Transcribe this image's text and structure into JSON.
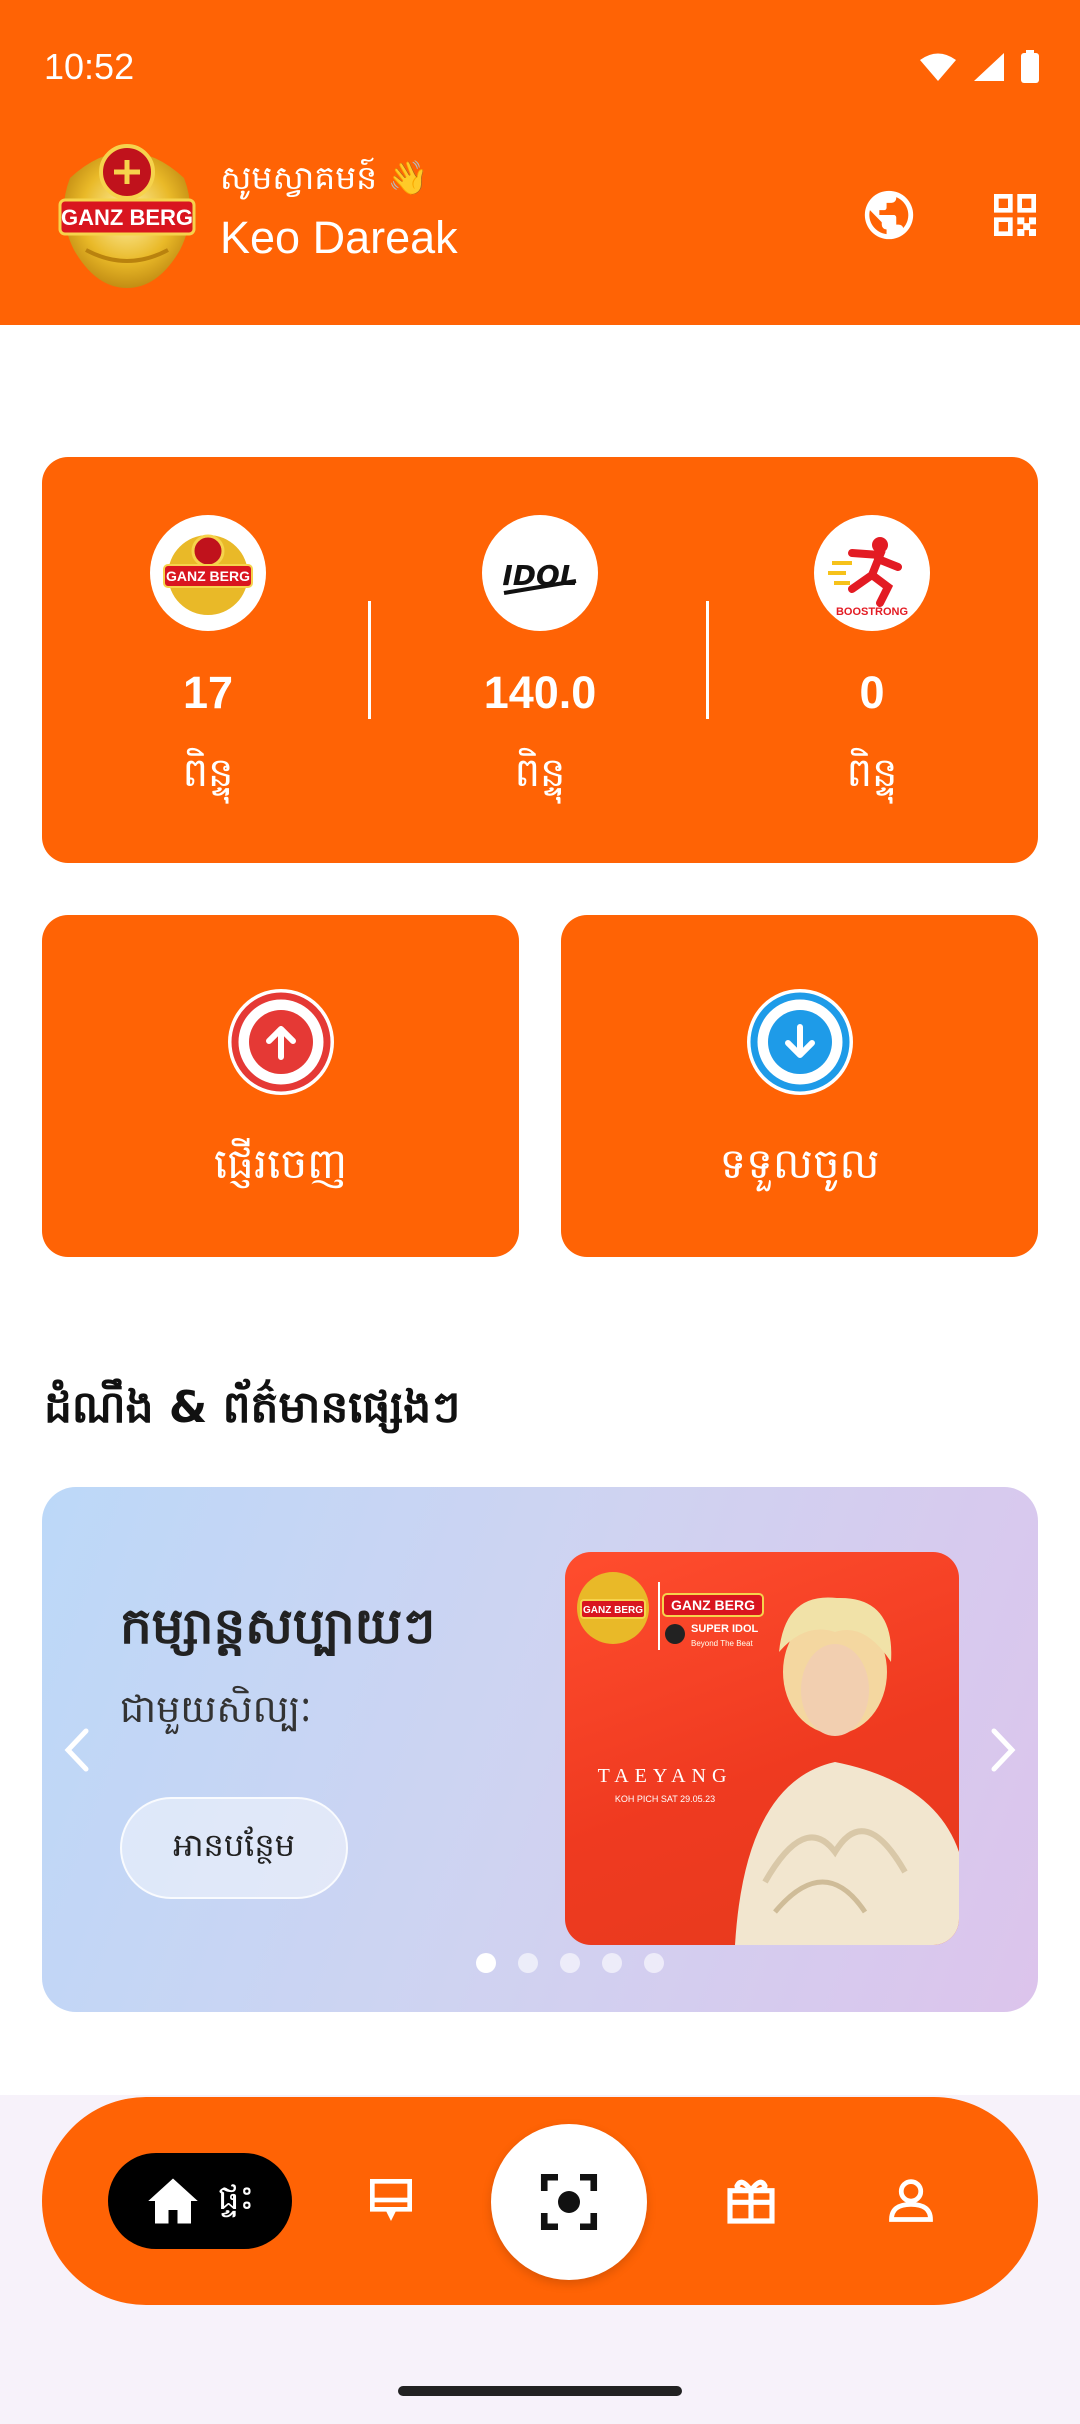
{
  "status_bar": {
    "time": "10:52",
    "icons": [
      "wifi-icon",
      "signal-icon",
      "battery-icon"
    ]
  },
  "header": {
    "brand_logo_text": "GANZ BERG",
    "greeting": "សូមស្វាគមន៍ 👋",
    "username": "Keo Dareak",
    "icons": [
      "globe-icon",
      "qr-code-icon"
    ]
  },
  "points": [
    {
      "brand": "GANZ BERG",
      "value": "17",
      "unit": "ពិន្ទុ"
    },
    {
      "brand": "IDOL",
      "value": "140.0",
      "unit": "ពិន្ទុ"
    },
    {
      "brand": "BOOSTRONG",
      "value": "0",
      "unit": "ពិន្ទុ"
    }
  ],
  "actions": {
    "send_label": "ផ្ញើរចេញ",
    "receive_label": "ទទួលចូល"
  },
  "news": {
    "section_title": "ដំណឹង & ព័ត៌មានផ្សេងៗ",
    "banner": {
      "title": "កម្សាន្តសប្បាយៗ",
      "subtitle": "ជាមួយសិល្បៈ",
      "button_label": "អានបន្ថែម",
      "image_logo_text": "GANZ BERG",
      "image_sub_logo": "SUPER IDOL",
      "image_sub_tagline": "Beyond The Beat",
      "image_artist": "TAEYANG",
      "image_caption": "KOH PICH  SAT 29.05.23"
    },
    "dots_total": 5,
    "dots_active": 1
  },
  "bottom_nav": {
    "home_label": "ផ្ទះ",
    "items": [
      "home-icon",
      "card-icon",
      "scan-icon",
      "gift-icon",
      "profile-icon"
    ]
  },
  "colors": {
    "brand_orange": "#FF6305",
    "send_red": "#E53935",
    "receive_blue": "#1E9BE8"
  }
}
